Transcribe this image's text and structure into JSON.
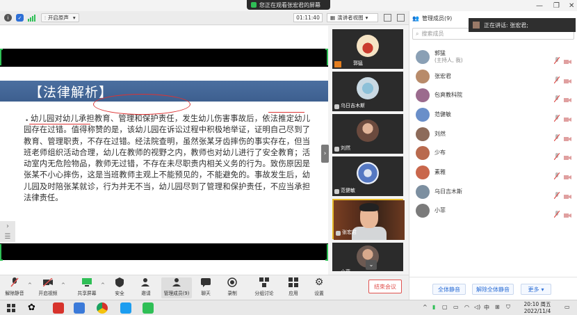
{
  "share_banner": "您正在观看张宏君的屏幕",
  "toolbar": {
    "audio_label": "开启原声",
    "timer": "01:11:40",
    "view_label": "演讲者视图"
  },
  "slide": {
    "title": "【法律解析】",
    "body": "幼儿园对幼儿承担教育、管理和保护责任，发生幼儿伤害事故后，依法推定幼儿园存在过错。值得称赞的是，该幼儿园在诉讼过程中积极地举证，证明自己尽到了教育、管理职责，不存在过错。经法院查明，虽然张某牙齿摔伤的事实存在，但当班老师组织活动合理，幼儿在教师的视野之内，教师也对幼儿进行了安全教育；活动室内无危险物品，教师无过错，不存在未尽职责内相关义务的行为。致伤原因是张某不小心摔伤，这是当班教师主观上不能预见的，不能避免的。事故发生后，幼儿园及时陪张某就诊，行为并无不当，幼儿园尽到了管理和保护责任，不应当承担法律责任。"
  },
  "video_tiles": [
    {
      "name": "郭猛"
    },
    {
      "name": "乌日吉木斯"
    },
    {
      "name": "刘然"
    },
    {
      "name": "范健敏"
    },
    {
      "name": "张宏君"
    },
    {
      "name": "小菲"
    }
  ],
  "panel": {
    "title": "管理成员(9)",
    "search_placeholder": "搜索成员",
    "speaking": "正在讲话: 张宏君;",
    "participants": [
      {
        "name": "郭猛",
        "sub": "(主持人, 我)",
        "color": "#8aa0b5"
      },
      {
        "name": "张宏君",
        "sub": "",
        "color": "#b88b6a"
      },
      {
        "name": "包爽教科院",
        "sub": "",
        "color": "#9b6b8e"
      },
      {
        "name": "范健敏",
        "sub": "",
        "color": "#6a8fc9"
      },
      {
        "name": "刘然",
        "sub": "",
        "color": "#8d6b5a"
      },
      {
        "name": "少布",
        "sub": "",
        "color": "#b96a4e"
      },
      {
        "name": "素雅",
        "sub": "",
        "color": "#c9674c"
      },
      {
        "name": "乌日吉木斯",
        "sub": "",
        "color": "#7c8fa0"
      },
      {
        "name": "小菲",
        "sub": "",
        "color": "#7b7b7b"
      }
    ],
    "mute_all": "全体静音",
    "unmute_all": "解除全体静音",
    "more": "更多"
  },
  "controls": {
    "unmute": "解除静音",
    "video": "开启视频",
    "share": "共享屏幕",
    "security": "安全",
    "invite": "邀请",
    "members": "管理成员(9)",
    "chat": "聊天",
    "record": "录制",
    "breakout": "分组讨论",
    "apps": "应用",
    "settings": "设置",
    "end": "结束会议"
  },
  "taskbar": {
    "ime": "中",
    "time": "20:10 周五",
    "date": "2022/11/4"
  }
}
